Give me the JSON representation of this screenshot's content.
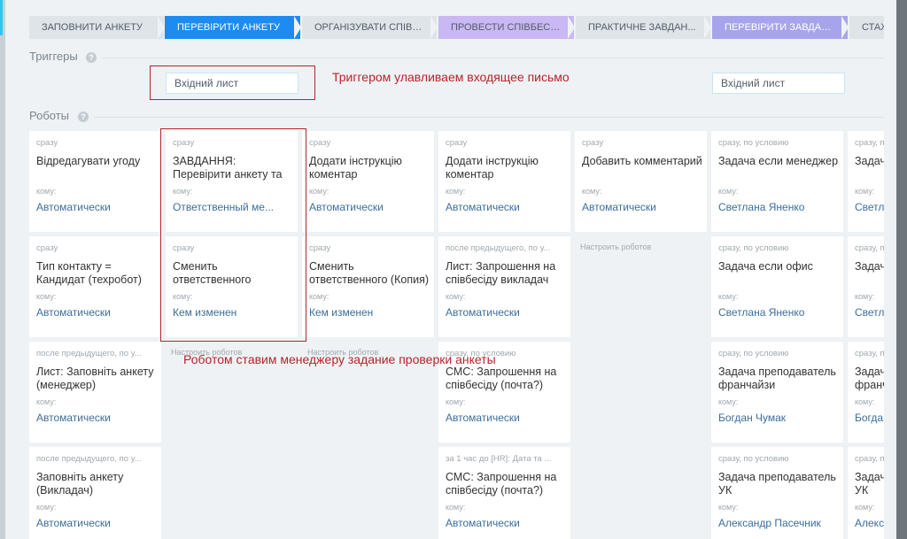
{
  "stages": [
    {
      "label": "ЗАПОВНИТИ АНКЕТУ",
      "color": "#dfe4e8"
    },
    {
      "label": "ПЕРЕВІРИТИ АНКЕТУ",
      "color": "#1c8cf2"
    },
    {
      "label": "ОРГАНІЗУВАТИ СПІВБ...",
      "color": "#dfe4e8"
    },
    {
      "label": "ПРОВЕСТИ СПІВБЕСІДУ",
      "color": "#c9b8f3"
    },
    {
      "label": "ПРАКТИЧНЕ ЗАВДАН...",
      "color": "#dfe4e8"
    },
    {
      "label": "ПЕРЕВІРИТИ ЗАВДАН...",
      "color": "#a8a4ec"
    },
    {
      "label": "СТАЖ",
      "color": "#dfe4e8"
    }
  ],
  "triggers": {
    "label": "Триггеры",
    "help": "?",
    "boxes": [
      "Вхідний лист",
      "Вхідний лист"
    ]
  },
  "robots": {
    "label": "Роботы",
    "help": "?"
  },
  "annotations": {
    "trigger_note": "Триггером улавливаем входящее письмо",
    "robot_note": "Роботом ставим менеджеру задание проверки анкеты"
  },
  "common": {
    "to_label": "кому:",
    "configure": "Настроить роботов"
  },
  "columns": [
    [
      {
        "cond": "сразу",
        "title": "Відредагувати угоду",
        "to": "Автоматически"
      },
      {
        "cond": "сразу",
        "title": "Тип контакту = Кандидат (техробот)",
        "to": "Автоматически"
      },
      {
        "cond": "после предыдущего, по у...",
        "title": "Лист: Заповніть анкету (менеджер)",
        "to": "Автоматически"
      },
      {
        "cond": "после предыдущего, по у...",
        "title": "Заповніть анкету (Викладач)",
        "to": "Автоматически"
      }
    ],
    [
      {
        "cond": "сразу",
        "title": "ЗАВДАННЯ: Перевірити анкету та",
        "to": "Ответственный ме..."
      },
      {
        "cond": "сразу",
        "title": "Сменить ответственного",
        "to": "Кем изменен"
      }
    ],
    [
      {
        "cond": "сразу",
        "title": "Додати інструкцію коментар",
        "to": "Автоматически"
      },
      {
        "cond": "сразу",
        "title": "Сменить ответственного (Копия)",
        "to": "Кем изменен"
      }
    ],
    [
      {
        "cond": "сразу",
        "title": "Додати інструкцію коментар",
        "to": "Автоматически"
      },
      {
        "cond": "после предыдущего, по у...",
        "title": "Лист: Запрошення на співбесіду викладач",
        "to": "Автоматически"
      },
      {
        "cond": "сразу, по условию",
        "title": "СМС: Запрошення на співбесіду (почта?)",
        "to": "Автоматически"
      },
      {
        "cond": "за 1 час до [HR]: Дата та ...",
        "title": "СМС: Запрошення на співбесіду (почта?)",
        "to": "Автоматически"
      }
    ],
    [
      {
        "cond": "сразу",
        "title": "Добавить комментарий",
        "to": "Автоматически"
      }
    ],
    [
      {
        "cond": "сразу, по условию",
        "title": "Задача если менеджер",
        "to": "Светлана Яненко"
      },
      {
        "cond": "сразу, по условию",
        "title": "Задача если офис",
        "to": "Светлана Яненко"
      },
      {
        "cond": "сразу, по условию",
        "title": "Задача преподаватель франчайзи",
        "to": "Богдан Чумак"
      },
      {
        "cond": "сразу, по условию",
        "title": "Задача преподаватель УК",
        "to": "Александр Пасечник"
      }
    ],
    [
      {
        "cond": "сразу, по условию",
        "title": "Задача если менеджер",
        "to": "Светлана Яненко"
      },
      {
        "cond": "сразу, по условию",
        "title": "Задача если офис",
        "to": "Светлана Яненко"
      },
      {
        "cond": "сразу, по условию",
        "title": "Задача преподаватель франчайзи",
        "to": "Богдан Чумак"
      },
      {
        "cond": "сразу, по условию",
        "title": "Задача преподаватель УК",
        "to": "Александр Пасечник"
      }
    ]
  ]
}
